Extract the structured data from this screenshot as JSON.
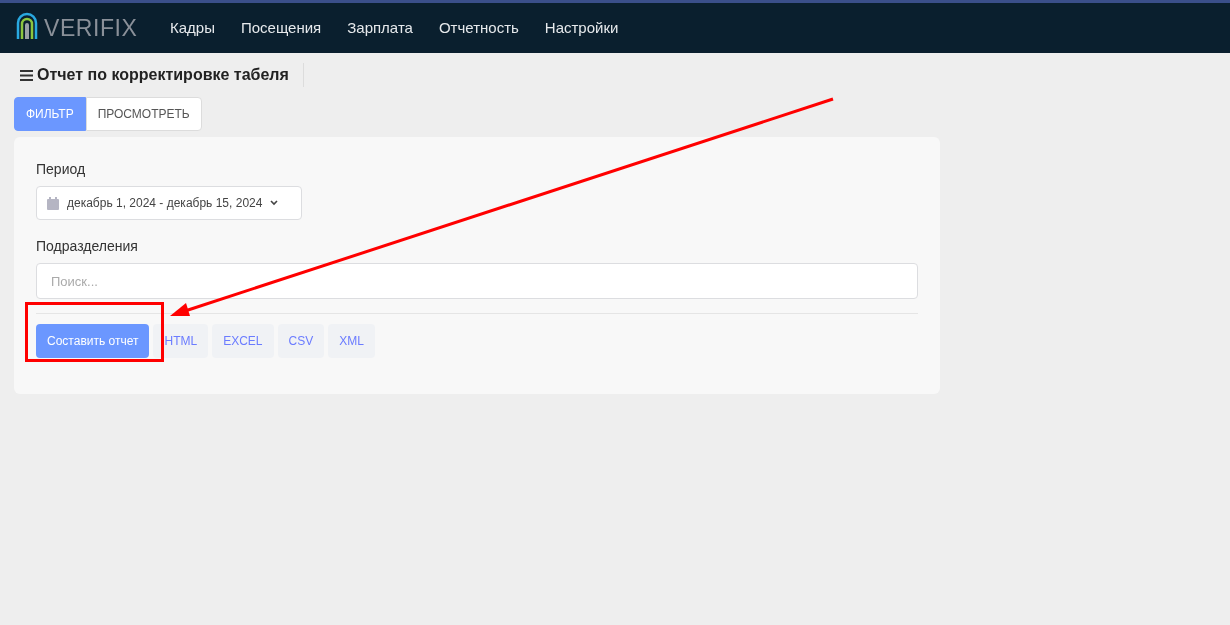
{
  "header": {
    "logo": "VERIFIX",
    "nav": [
      {
        "label": "Кадры"
      },
      {
        "label": "Посещения"
      },
      {
        "label": "Зарплата"
      },
      {
        "label": "Отчетность"
      },
      {
        "label": "Настройки"
      }
    ]
  },
  "page_title": "Отчет по корректировке табеля",
  "tabs": [
    {
      "label": "ФИЛЬТР",
      "selected": true
    },
    {
      "label": "ПРОСМОТРЕТЬ",
      "selected": false
    }
  ],
  "filter": {
    "period_label": "Период",
    "period_value": "декабрь 1, 2024 - декабрь 15, 2024",
    "divisions_label": "Подразделения",
    "divisions_placeholder": "Поиск..."
  },
  "actions": {
    "primary": "Составить отчет",
    "formats": [
      "HTML",
      "EXCEL",
      "CSV",
      "XML"
    ]
  }
}
